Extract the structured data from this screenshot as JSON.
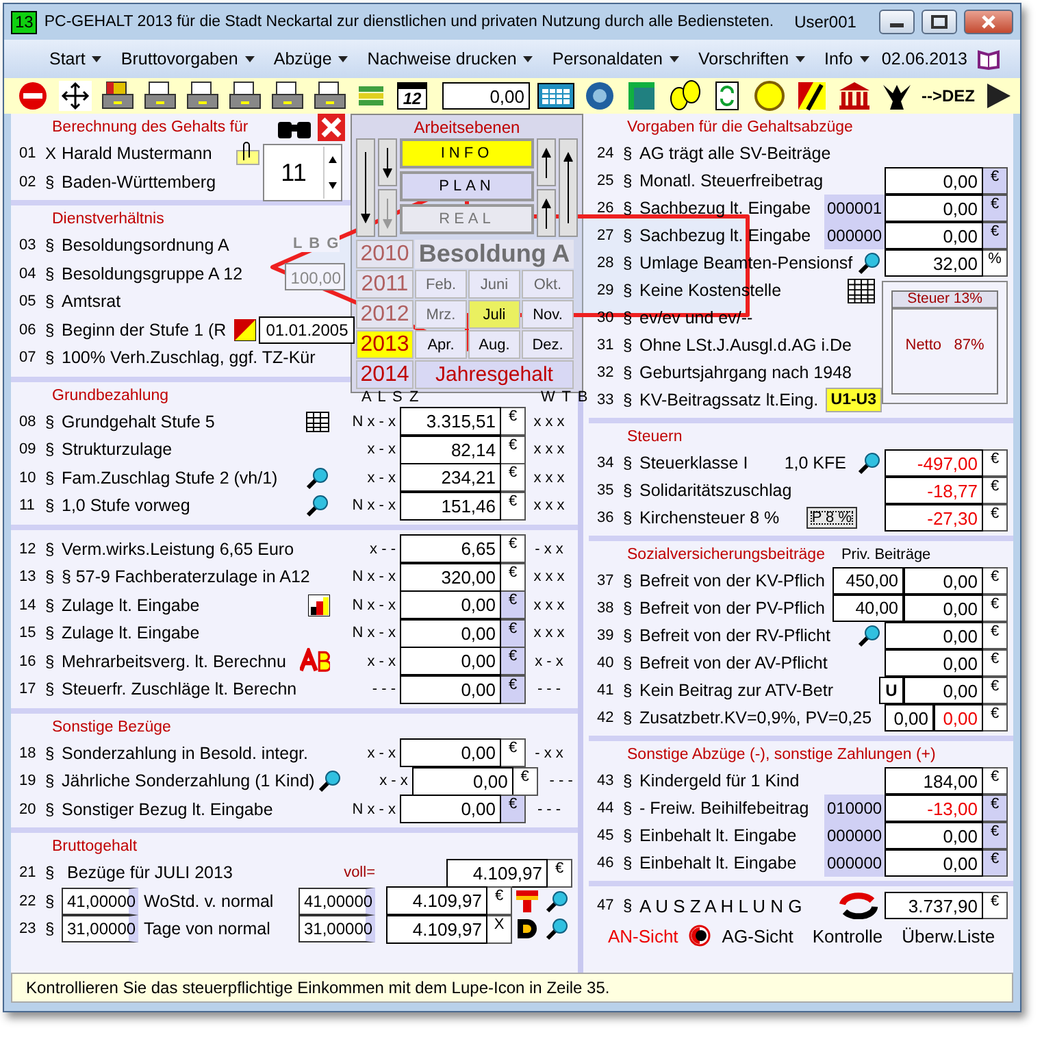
{
  "window": {
    "badge": "13",
    "title": "PC-GEHALT 2013 für die Stadt Neckartal zur dienstlichen und privaten Nutzung durch alle Bediensteten.",
    "user": "User001"
  },
  "menu": [
    {
      "label": "Start",
      "dropdown": true
    },
    {
      "label": "Bruttovorgaben",
      "dropdown": true
    },
    {
      "label": "Abzüge",
      "dropdown": true
    },
    {
      "label": "Nachweise drucken",
      "dropdown": true
    },
    {
      "label": "Personaldaten",
      "dropdown": true
    },
    {
      "label": "Vorschriften",
      "dropdown": true
    },
    {
      "label": "Info",
      "dropdown": true
    }
  ],
  "menu_date": "02.06.2013",
  "toolbar": {
    "calendar_day": "12",
    "field": "0,00",
    "dez": "-->DEZ"
  },
  "left": [
    {
      "kind": "person",
      "title": "Berechnung des Gehalts für",
      "spinner": "11",
      "rows": [
        {
          "num": "01",
          "sym": "X",
          "label": "Harald Mustermann"
        },
        {
          "num": "02",
          "sym": "§",
          "label": "Baden-Württemberg"
        }
      ]
    },
    {
      "kind": "service",
      "title": "Dienstverhältnis",
      "lbg": "L B G",
      "lbg_value": "100,00",
      "rows": [
        {
          "num": "03",
          "sym": "§",
          "label": "Besoldungsordnung A"
        },
        {
          "num": "04",
          "sym": "§",
          "label": "Besoldungsgruppe A 12"
        },
        {
          "num": "05",
          "sym": "§",
          "label": "Amtsrat"
        },
        {
          "num": "06",
          "sym": "§",
          "label": "Beginn der Stufe 1 (R",
          "date": "01.01.2005"
        },
        {
          "num": "07",
          "sym": "§",
          "label": "100% Verh.Zuschlag, ggf. TZ-Kür"
        }
      ]
    },
    {
      "kind": "amounts",
      "title": "Grundbezahlung",
      "col_left": "A L S Z",
      "col_right": "W T B",
      "rows": [
        {
          "num": "08",
          "sym": "§",
          "label": "Grundgehalt Stufe 5",
          "flags": "N x - x",
          "amount": "3.315,51",
          "unit": "€",
          "shaded": false,
          "wtb": "x x x"
        },
        {
          "num": "09",
          "sym": "§",
          "label": "Strukturzulage",
          "flags": "x - x",
          "amount": "82,14",
          "unit": "€",
          "shaded": false,
          "wtb": "x x x"
        },
        {
          "num": "10",
          "sym": "§",
          "label": "Fam.Zuschlag Stufe 2 (vh/1)",
          "flags": "x - x",
          "amount": "234,21",
          "unit": "€",
          "shaded": false,
          "wtb": "x x x"
        },
        {
          "num": "11",
          "sym": "§",
          "label": "1,0 Stufe   vorweg",
          "flags": "N x - x",
          "amount": "151,46",
          "unit": "€",
          "shaded": false,
          "wtb": "x x x"
        }
      ]
    },
    {
      "kind": "amounts",
      "rows": [
        {
          "num": "12",
          "sym": "§",
          "label": "Verm.wirks.Leistung   6,65 Euro",
          "flags": "x - -",
          "amount": "6,65",
          "unit": "€",
          "shaded": false,
          "wtb": "- x x"
        },
        {
          "num": "13",
          "sym": "§",
          "label": "§ 57-9 Fachberaterzulage in A12",
          "flags": "N x - x",
          "amount": "320,00",
          "unit": "€",
          "shaded": false,
          "wtb": "x x x"
        },
        {
          "num": "14",
          "sym": "§",
          "label": "Zulage lt. Eingabe",
          "flags": "N x - x",
          "amount": "0,00",
          "unit": "€",
          "shaded": true,
          "wtb": "x x x"
        },
        {
          "num": "15",
          "sym": "§",
          "label": "Zulage lt. Eingabe",
          "flags": "N x - x",
          "amount": "0,00",
          "unit": "€",
          "shaded": true,
          "wtb": "x x x"
        },
        {
          "num": "16",
          "sym": "§",
          "label": "Mehrarbeitsverg. lt. Berechnu",
          "flags": "x - x",
          "amount": "0,00",
          "unit": "€",
          "shaded": true,
          "wtb": "x - x"
        },
        {
          "num": "17",
          "sym": "§",
          "label": "Steuerfr. Zuschläge lt. Berechn",
          "flags": "- - -",
          "amount": "0,00",
          "unit": "€",
          "shaded": true,
          "wtb": "- - -"
        }
      ]
    },
    {
      "kind": "amounts",
      "title": "Sonstige Bezüge",
      "rows": [
        {
          "num": "18",
          "sym": "§",
          "label": "Sonderzahlung in Besold. integr.",
          "flags": "x - x",
          "amount": "0,00",
          "unit": "€",
          "shaded": false,
          "wtb": "- x x"
        },
        {
          "num": "19",
          "sym": "§",
          "label": "Jährliche Sonderzahlung (1 Kind)",
          "flags": "x - x",
          "amount": "0,00",
          "unit": "€",
          "shaded": false,
          "wtb": "- - -"
        },
        {
          "num": "20",
          "sym": "§",
          "label": "Sonstiger Bezug lt. Eingabe",
          "flags": "N x - x",
          "amount": "0,00",
          "unit": "€",
          "shaded": true,
          "wtb": "- - -"
        }
      ]
    },
    {
      "kind": "gross",
      "title": "Bruttogehalt",
      "rows": [
        {
          "num": "21",
          "sym": "§",
          "label": "Bezüge für JULI  2013",
          "note": "voll=",
          "amount": "4.109,97",
          "unit": "€"
        },
        {
          "num": "22",
          "sym": "§",
          "field": "41,00000",
          "label": "WoStd. v. normal",
          "field2": "41,00000",
          "amount": "4.109,97",
          "unit": "€"
        },
        {
          "num": "23",
          "sym": "§",
          "field": "31,00000",
          "label": "Tage von normal",
          "field2": "31,00000",
          "amount": "4.109,97",
          "unit": "X"
        }
      ]
    }
  ],
  "right": [
    {
      "title": "Vorgaben für die Gehaltsabzüge",
      "rows": [
        {
          "num": "24",
          "sym": "§",
          "label": "AG trägt alle SV-Beiträge"
        },
        {
          "num": "25",
          "sym": "§",
          "label": "Monatl. Steuerfreibetrag",
          "amount": "0,00",
          "unit": "€",
          "shaded": true
        },
        {
          "num": "26",
          "sym": "§",
          "label": "Sachbezug lt. Eingabe",
          "code": "000001",
          "amount": "0,00",
          "unit": "€",
          "shaded": true
        },
        {
          "num": "27",
          "sym": "§",
          "label": "Sachbezug lt. Eingabe",
          "code": "000000",
          "amount": "0,00",
          "unit": "€",
          "shaded": true
        },
        {
          "num": "28",
          "sym": "§",
          "label": "Umlage Beamten-Pensionsf",
          "amount": "32,00",
          "unit": "%",
          "shaded": false
        },
        {
          "num": "29",
          "sym": "§",
          "label": "Keine Kostenstelle"
        },
        {
          "num": "30",
          "sym": "§",
          "label": "ev/ev und ev/--"
        },
        {
          "num": "31",
          "sym": "§",
          "label": "Ohne LSt.J.Ausgl.d.AG i.De"
        },
        {
          "num": "32",
          "sym": "§",
          "label": "Geburtsjahrgang nach 1948"
        },
        {
          "num": "33",
          "sym": "§",
          "label": "KV-Beitragssatz lt.Eing.",
          "badge": "U1-U3"
        }
      ]
    },
    {
      "title": "Steuern",
      "rows": [
        {
          "num": "34",
          "sym": "§",
          "label": "Steuerklasse I",
          "extra": "1,0 KFE",
          "amount": "-497,00",
          "alert": true,
          "unit": "€",
          "shaded": false
        },
        {
          "num": "35",
          "sym": "§",
          "label": "Solidaritätszuschlag",
          "amount": "-18,77",
          "alert": true,
          "unit": "€",
          "shaded": false
        },
        {
          "num": "36",
          "sym": "§",
          "label": "Kirchensteuer 8 %",
          "button": "P 8 %",
          "amount": "-27,30",
          "alert": true,
          "unit": "€",
          "shaded": false
        }
      ]
    },
    {
      "title": "Sozialversicherungsbeiträge",
      "subtitle": "Priv. Beiträge",
      "rows": [
        {
          "num": "37",
          "sym": "§",
          "label": "Befreit von der KV-Pflich",
          "priv": "450,00",
          "amount": "0,00",
          "unit": "€",
          "shaded": false
        },
        {
          "num": "38",
          "sym": "§",
          "label": "Befreit von der PV-Pflich",
          "priv": "40,00",
          "amount": "0,00",
          "unit": "€",
          "shaded": false
        },
        {
          "num": "39",
          "sym": "§",
          "label": "Befreit von der RV-Pflicht",
          "amount": "0,00",
          "unit": "€",
          "shaded": false
        },
        {
          "num": "40",
          "sym": "§",
          "label": "Befreit von der AV-Pflicht",
          "amount": "0,00",
          "unit": "€",
          "shaded": false
        },
        {
          "num": "41",
          "sym": "§",
          "label": "Kein Beitrag zur ATV-Betr",
          "tag": "U",
          "amount": "0,00",
          "unit": "€",
          "shaded": false
        },
        {
          "num": "42",
          "sym": "§",
          "label": "Zusatzbetr.KV=0,9%, PV=0,25",
          "amount2": "0,00",
          "amount": "0,00",
          "alert": true,
          "unit": "€",
          "shaded": false
        }
      ]
    },
    {
      "title": "Sonstige Abzüge (-), sonstige Zahlungen (+)",
      "rows": [
        {
          "num": "43",
          "sym": "§",
          "label": "Kindergeld für 1 Kind",
          "amount": "184,00",
          "unit": "€",
          "shaded": false
        },
        {
          "num": "44",
          "sym": "§",
          "label": "- Freiw. Beihilfebeitrag",
          "code": "010000",
          "amount": "-13,00",
          "alert": true,
          "unit": "€",
          "shaded": true
        },
        {
          "num": "45",
          "sym": "§",
          "label": "Einbehalt lt. Eingabe",
          "code": "000000",
          "amount": "0,00",
          "unit": "€",
          "shaded": true
        },
        {
          "num": "46",
          "sym": "§",
          "label": "Einbehalt lt. Eingabe",
          "code": "000000",
          "amount": "0,00",
          "unit": "€",
          "shaded": true
        }
      ]
    }
  ],
  "payout": {
    "num": "47",
    "sym": "§",
    "label": "A U S Z A H L U N G",
    "amount": "3.737,90",
    "unit": "€"
  },
  "views": [
    {
      "label": "AN-Sicht",
      "selected": true
    },
    {
      "label": "AG-Sicht",
      "selected": false
    },
    {
      "label": "Kontrolle",
      "selected": false
    },
    {
      "label": "Überw.Liste",
      "selected": false
    }
  ],
  "tax_box": {
    "steuer": "Steuer 13%",
    "netto": "Netto   87%"
  },
  "levels_panel": {
    "title": "Arbeitsebenen",
    "annual": "Jahresgehalt",
    "modes": [
      {
        "label": "INFO",
        "selected": true,
        "disabled": false
      },
      {
        "label": "PLAN",
        "selected": false,
        "disabled": false
      },
      {
        "label": "REAL",
        "selected": false,
        "disabled": true
      }
    ],
    "years": [
      {
        "label": "2010",
        "selected": false,
        "disabled": true
      },
      {
        "label": "2011",
        "selected": false,
        "disabled": true
      },
      {
        "label": "2012",
        "selected": false,
        "disabled": true
      },
      {
        "label": "2013",
        "selected": true,
        "disabled": false
      },
      {
        "label": "2014",
        "selected": false,
        "disabled": false
      }
    ],
    "months": [
      {
        "label": "Feb.",
        "selected": false,
        "disabled": true
      },
      {
        "label": "Juni",
        "selected": false,
        "disabled": true
      },
      {
        "label": "Okt.",
        "selected": false,
        "disabled": true
      },
      {
        "label": "Mrz.",
        "selected": false,
        "disabled": true
      },
      {
        "label": "Juli",
        "selected": true,
        "disabled": false
      },
      {
        "label": "Nov.",
        "selected": false,
        "disabled": false
      },
      {
        "label": "Apr.",
        "selected": false,
        "disabled": false
      },
      {
        "label": "Aug.",
        "selected": false,
        "disabled": false
      },
      {
        "label": "Dez.",
        "selected": false,
        "disabled": false
      }
    ]
  },
  "callout": {
    "text": "Besoldung A"
  },
  "status": "Kontrollieren Sie das steuerpflichtige Einkommen mit dem Lupe-Icon in Zeile 35."
}
